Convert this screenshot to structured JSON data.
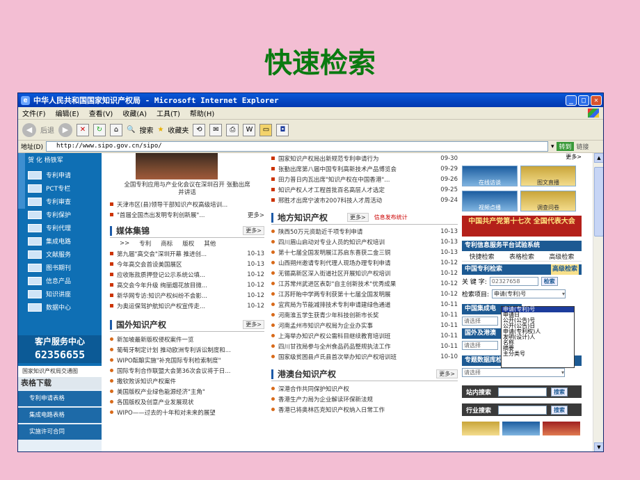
{
  "slide": {
    "title": "快速检索"
  },
  "window": {
    "title": "中华人民共和国国家知识产权局 - Microsoft Internet Explorer",
    "menu": [
      "文件(F)",
      "编辑(E)",
      "查看(V)",
      "收藏(A)",
      "工具(T)",
      "帮助(H)"
    ],
    "toolbar": {
      "back": "后退",
      "search": "搜索",
      "favorites": "收藏夹"
    },
    "address_label": "地址(D)",
    "address": "http://www.sipo.gov.cn/sipo/",
    "go": "转到",
    "links": "链接"
  },
  "left_nav": {
    "top": "贺 化 杨铁军",
    "items": [
      "专利申请",
      "PCT专栏",
      "专利审查",
      "专利保护",
      "专利代理",
      "集成电路",
      "文献服务",
      "图书期刊",
      "信息产品",
      "知识讲座",
      "数据中心"
    ],
    "service_title": "客户服务中心",
    "service_phone": "62356655",
    "traffic": "国家知识产权局交通图",
    "forms_title": "表格下载",
    "forms": [
      "专利申请表格",
      "集成电路表格",
      "实施许可合同"
    ]
  },
  "middle": {
    "photo_caption": "全国专利应用与产业化会议在深圳召开 张勤出席并讲话",
    "top_news": [
      {
        "text": "天津市区(县)领导干部知识产权高级培训...",
        "date": ""
      },
      {
        "text": "\"首届全国杰出发明专利创新展\"...",
        "date": "更多>"
      }
    ],
    "media": {
      "title": "媒体集锦",
      "more": "更多>",
      "cols": [
        ">>",
        "专利",
        "商标",
        "版权",
        "其他"
      ],
      "items": [
        {
          "text": "第九届\"高交会\"深圳开幕 推进创...",
          "date": "10-13"
        },
        {
          "text": "今年高交会首设美国展区",
          "date": "10-13"
        },
        {
          "text": "应收账款质押登记公示系统公填...",
          "date": "10-12"
        },
        {
          "text": "高交会今年升级 绚丽烟花放目微...",
          "date": "10-12"
        },
        {
          "text": "新华网专访:知识产权纠纷不会影...",
          "date": "10-12"
        },
        {
          "text": "为奥运保驾护航知识产权宣传走...",
          "date": "10-12"
        }
      ]
    },
    "foreign": {
      "title": "国外知识产权",
      "more": "更多>",
      "items": [
        "新加坡最新版权侵权案件一览",
        "葡萄牙制定计划 推动欧洲专利诉讼制度和...",
        "WIPO酝酿实施\"补充国际专利检索制度\"",
        "国际专利合作联盟大会第36次会议将于日...",
        "撒钦败诉知识产权案件",
        "美国版权产业绿色能源经济\"主角\"",
        "各国版权及创意产业发展现状",
        "WIPO——过去的十年和对未来的展望"
      ]
    }
  },
  "right": {
    "top_news": [
      {
        "text": "国家知识产权局出新规范专利申请行为",
        "date": "09-30"
      },
      {
        "text": "张勤出席第八届中国专利高新技术产品博览会",
        "date": "09-29"
      },
      {
        "text": "田力普日内瓦出席\"知识产权在中国香港\"...",
        "date": "09-26"
      },
      {
        "text": "知识产权人才工程首批百名高层人才选定",
        "date": "09-25"
      },
      {
        "text": "邢胜才出席宁波市2007科技人才周活动",
        "date": "09-24"
      }
    ],
    "local": {
      "title": "地方知识产权",
      "more": "更多>",
      "extra": "信息发布统计",
      "items": [
        {
          "text": "陕西50万元资助近千项专利申请",
          "date": "10-13"
        },
        {
          "text": "四川眉山启动对专业人员的知识产权培训",
          "date": "10-13"
        },
        {
          "text": "第十七届全国发明展江苏启东喜获二金三铜",
          "date": "10-13"
        },
        {
          "text": "山西朔州邀请专利代理人现场办理专利申请",
          "date": "10-12"
        },
        {
          "text": "无锡高新区深入街道社区开展知识产权培训",
          "date": "10-12"
        },
        {
          "text": "江苏常州武进区表彰\"自主创新技术\"优秀成果",
          "date": "10-12"
        },
        {
          "text": "江苏盱眙中学两专利获第十七届全国发明展",
          "date": "10-12"
        },
        {
          "text": "宜宾局为节能减排技术专利申请建绿色通道",
          "date": "10-11"
        },
        {
          "text": "河南淮五学生获青少年科技创新市长奖",
          "date": "10-11"
        },
        {
          "text": "河南孟州市知识产权局为企业办实事",
          "date": "10-11"
        },
        {
          "text": "上海举办知识产权公需科目继续教育培训班",
          "date": "10-11"
        },
        {
          "text": "四川甘孜局参与全州食品药品整规执法工作",
          "date": "10-11"
        },
        {
          "text": "国家级贫困县卢氏县首次举办知识产权培训班",
          "date": "10-10"
        }
      ]
    },
    "hkmt": {
      "title": "港澳台知识产权",
      "more": "更多>",
      "items": [
        "深港合作共同保护知识产权",
        "香港生产力局为企业解读环保新法规",
        "香港已将奥林匹克知识产权纳入日常工作"
      ]
    }
  },
  "side": {
    "top_more": "更多>",
    "buttons": [
      "在线访谈",
      "图文直播",
      "视频点播",
      "调查问卷"
    ],
    "congress": "中国共产党第十七次 全国代表大会",
    "platform_title": "专利信息服务平台试验系统",
    "platform_items": [
      "快捷检索",
      "表格检索",
      "高级检索"
    ],
    "cn_title": "中国专利检索",
    "advanced_btn": "高级检索",
    "keyword_label": "关 键 字:",
    "keyword_value": "02327658",
    "search_btn": "检索",
    "field_label": "检索项目:",
    "field_value": "申请(专利)号",
    "dropdown_options": [
      "申请(专利)号",
      "申请日",
      "公开(公告)号",
      "公开(公告)日",
      "申请(专利权)人",
      "发明(设计)人",
      "名称",
      "摘要",
      "主分类号"
    ],
    "ic_title": "中国集成电",
    "select_placeholder": "请选择",
    "foreign_title": "国外及港澳",
    "topic_title": "专题数据库检索",
    "site_search": "站内搜索",
    "industry_search": "行业搜索",
    "search_label": "搜索"
  }
}
